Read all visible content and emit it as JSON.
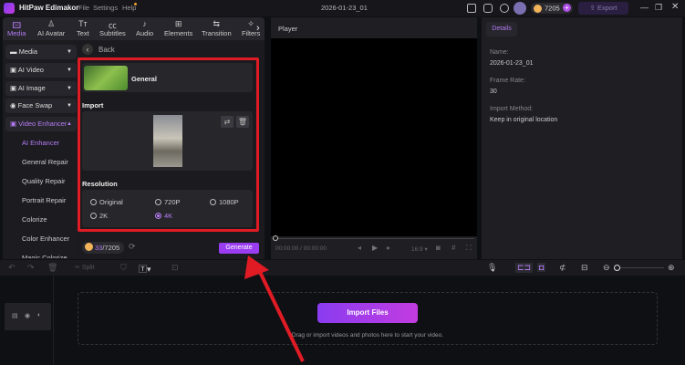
{
  "titlebar": {
    "app_name": "HitPaw Edimakor",
    "menus": [
      "File",
      "Settings",
      "Help"
    ],
    "project_title": "2026-01-23_01",
    "credits": "7205",
    "export_label": "Export"
  },
  "tabs": [
    {
      "label": "Media",
      "icon": "🖾",
      "active": true
    },
    {
      "label": "AI Avatar",
      "icon": "♙"
    },
    {
      "label": "Text",
      "icon": "Tт"
    },
    {
      "label": "Subtitles",
      "icon": "㏄"
    },
    {
      "label": "Audio",
      "icon": "♪"
    },
    {
      "label": "Elements",
      "icon": "⊞"
    },
    {
      "label": "Transition",
      "icon": "⇆"
    },
    {
      "label": "Filters",
      "icon": "✧"
    }
  ],
  "sidebar": {
    "groups": [
      "Media",
      "AI Video",
      "AI Image",
      "Face Swap",
      "Video Enhancer"
    ],
    "active_group": "Video Enhancer",
    "subitems": [
      "AI Enhancer",
      "General Repair",
      "Quality Repair",
      "Portrait Repair",
      "Colorize",
      "Color Enhancer",
      "Magic Colorize"
    ],
    "active_subitem": "AI Enhancer"
  },
  "enhancer": {
    "back_label": "Back",
    "model_name": "General",
    "import_label": "Import",
    "resolution_label": "Resolution",
    "resolutions": [
      "Original",
      "720P",
      "1080P",
      "2K",
      "4K"
    ],
    "selected_resolution": "4K",
    "cost_used": "33",
    "cost_total": "/7205",
    "generate_label": "Generate"
  },
  "player": {
    "title": "Player",
    "time_current": "00:00:00",
    "time_total": "/ 00:00:00",
    "aspect": "16:9"
  },
  "details": {
    "tab": "Details",
    "fields": [
      {
        "label": "Name:",
        "value": "2026-01-23_01"
      },
      {
        "label": "Frame Rate:",
        "value": "30"
      },
      {
        "label": "Import Method:",
        "value": "Keep in original location"
      }
    ]
  },
  "timeline": {
    "split_label": "Split",
    "import_label": "Import Files",
    "hint": "Drag or import videos and photos here to start your video."
  },
  "colors": {
    "accent": "#b150e8",
    "highlight": "#e01b24"
  }
}
